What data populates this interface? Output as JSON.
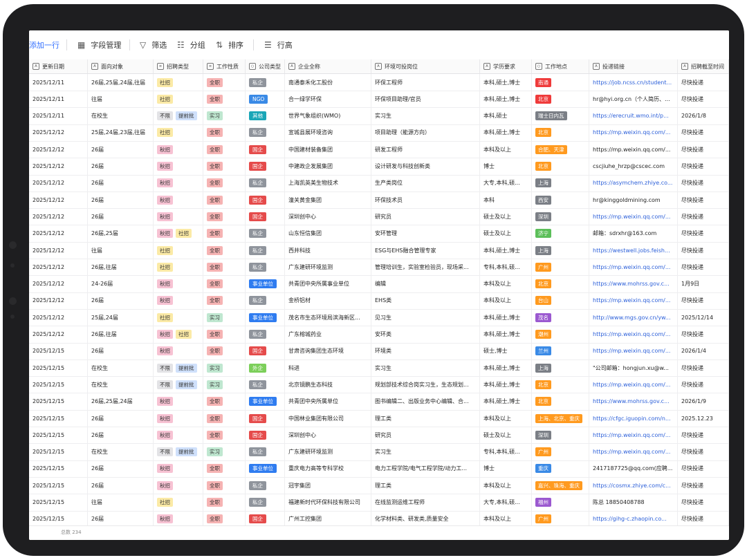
{
  "toolbar": {
    "add_row": "添加一行",
    "field_manage": "字段管理",
    "filter": "筛选",
    "group": "分组",
    "sort": "排序",
    "row_height": "行高"
  },
  "columns": [
    {
      "key": "date",
      "label": "更新日期",
      "icon": "A"
    },
    {
      "key": "target",
      "label": "面向对象",
      "icon": "A"
    },
    {
      "key": "rec",
      "label": "招聘类型",
      "icon": "≡"
    },
    {
      "key": "nature",
      "label": "工作性质",
      "icon": "≡"
    },
    {
      "key": "ctype",
      "label": "公司类型",
      "icon": "○"
    },
    {
      "key": "company",
      "label": "企业全称",
      "icon": "A"
    },
    {
      "key": "position",
      "label": "环境可投岗位",
      "icon": "A"
    },
    {
      "key": "edu",
      "label": "学历要求",
      "icon": "A"
    },
    {
      "key": "loc",
      "label": "工作地点",
      "icon": "○"
    },
    {
      "key": "link",
      "label": "投递链接",
      "icon": "A"
    },
    {
      "key": "deadline",
      "label": "招聘截至时间",
      "icon": "A"
    }
  ],
  "colors": {
    "tag_shezhao": "#fbeaa6",
    "tag_qiuzhao": "#f7c2d3",
    "tag_buxian": "#e3e3e6",
    "tag_tiqianpi": "#cfe0fb",
    "tag_quanzhi": "#f6b3b3",
    "tag_shixi": "#bfe7d0",
    "ctype_siqi": "#8f949c",
    "ctype_guoqi": "#e54b4b",
    "ctype_ngo": "#3a8ae6",
    "ctype_qita": "#1aa6b7",
    "ctype_shiye": "#2f7cf0",
    "ctype_waiqi": "#7ccf5a",
    "link": "#2b5fd9"
  },
  "rows": [
    {
      "date": "2025/12/11",
      "target": "26届,25届,24届,往届",
      "rec": [
        [
          "社招",
          "#fbeaa6"
        ]
      ],
      "nature": [
        [
          "全职",
          "#f6b3b3"
        ]
      ],
      "ctype": [
        "私企",
        "#8f949c"
      ],
      "company": "南通泰禾化工股份",
      "position": "环保工程师",
      "edu": "本科,硕士,博士",
      "loc": [
        [
          "南通",
          "#ef3b3b"
        ]
      ],
      "link": "https://job.ncss.cn/student...",
      "link_style": "link",
      "deadline": "尽快投递"
    },
    {
      "date": "2025/12/11",
      "target": "往届",
      "rec": [
        [
          "社招",
          "#fbeaa6"
        ]
      ],
      "nature": [
        [
          "全职",
          "#f6b3b3"
        ]
      ],
      "ctype": [
        "NGO",
        "#3a8ae6"
      ],
      "company": "合一绿学环保",
      "position": "环保项目助理/官员",
      "edu": "本科,硕士,博士",
      "loc": [
        [
          "北京",
          "#ef3b3b"
        ]
      ],
      "link": "hr@hyi.org.cn（个人简历、...",
      "link_style": "plain",
      "deadline": "尽快投递"
    },
    {
      "date": "2025/12/11",
      "target": "在校生",
      "rec": [
        [
          "不限",
          "#e3e3e6"
        ],
        [
          "提前批",
          "#cfe0fb"
        ]
      ],
      "nature": [
        [
          "实习",
          "#bfe7d0"
        ]
      ],
      "ctype": [
        "其他",
        "#1aa6b7"
      ],
      "company": "世界气象组织(WMO)",
      "position": "实习生",
      "edu": "本科,硕士",
      "loc": [
        [
          "瑞士日内瓦",
          "#7b7f86"
        ]
      ],
      "link": "https://erecruit.wmo.int/p...",
      "link_style": "link",
      "deadline": "2026/1/8"
    },
    {
      "date": "2025/12/12",
      "target": "25届,24届,23届,往届",
      "rec": [
        [
          "社招",
          "#fbeaa6"
        ]
      ],
      "nature": [
        [
          "全职",
          "#f6b3b3"
        ]
      ],
      "ctype": [
        "私企",
        "#8f949c"
      ],
      "company": "宣城县展环境咨询",
      "position": "项目助理（能源方向）",
      "edu": "本科,硕士,博士",
      "loc": [
        [
          "北京",
          "#ff9a1f"
        ]
      ],
      "link": "https://mp.weixin.qq.com/...",
      "link_style": "link",
      "deadline": "尽快投递"
    },
    {
      "date": "2025/12/12",
      "target": "26届",
      "rec": [
        [
          "秋招",
          "#f7c2d3"
        ]
      ],
      "nature": [
        [
          "全职",
          "#f6b3b3"
        ]
      ],
      "ctype": [
        "国企",
        "#e54b4b"
      ],
      "company": "中国建材装备集团",
      "position": "研发工程师",
      "edu": "本科及以上",
      "loc": [
        [
          "合肥、天津",
          "#ff9a1f"
        ]
      ],
      "link": "https://mp.weixin.qq.com/...",
      "link_style": "plain",
      "deadline": "尽快投递"
    },
    {
      "date": "2025/12/12",
      "target": "26届",
      "rec": [
        [
          "秋招",
          "#f7c2d3"
        ]
      ],
      "nature": [
        [
          "全职",
          "#f6b3b3"
        ]
      ],
      "ctype": [
        "国企",
        "#e54b4b"
      ],
      "company": "中建政企发展集团",
      "position": "设计研发与科技创新类",
      "edu": "博士",
      "loc": [
        [
          "北京",
          "#ff9a1f"
        ]
      ],
      "link": "cscjiuhe_hrzp@cscec.com",
      "link_style": "plain",
      "deadline": "尽快投递"
    },
    {
      "date": "2025/12/12",
      "target": "26届",
      "rec": [
        [
          "秋招",
          "#f7c2d3"
        ]
      ],
      "nature": [
        [
          "全职",
          "#f6b3b3"
        ]
      ],
      "ctype": [
        "私企",
        "#8f949c"
      ],
      "company": "上海凯英美生物技术",
      "position": "生产类岗位",
      "edu": "大专,本科,硕...",
      "loc": [
        [
          "上海",
          "#7b7f86"
        ]
      ],
      "link": "https://asymchem.zhiye.co...",
      "link_style": "link",
      "deadline": "尽快投递"
    },
    {
      "date": "2025/12/12",
      "target": "26届",
      "rec": [
        [
          "秋招",
          "#f7c2d3"
        ]
      ],
      "nature": [
        [
          "全职",
          "#f6b3b3"
        ]
      ],
      "ctype": [
        "国企",
        "#e54b4b"
      ],
      "company": "潼关黄金集团",
      "position": "环保技术员",
      "edu": "本科",
      "loc": [
        [
          "西安",
          "#7b7f86"
        ]
      ],
      "link": "hr@kinggoldmining.com",
      "link_style": "plain",
      "deadline": "尽快投递"
    },
    {
      "date": "2025/12/12",
      "target": "26届",
      "rec": [
        [
          "秋招",
          "#f7c2d3"
        ]
      ],
      "nature": [
        [
          "全职",
          "#f6b3b3"
        ]
      ],
      "ctype": [
        "国企",
        "#e54b4b"
      ],
      "company": "深圳创中心",
      "position": "研究员",
      "edu": "硕士及以上",
      "loc": [
        [
          "深圳",
          "#7b7f86"
        ]
      ],
      "link": "https://mp.weixin.qq.com/...",
      "link_style": "link",
      "deadline": "尽快投递"
    },
    {
      "date": "2025/12/12",
      "target": "26届,25届",
      "rec": [
        [
          "秋招",
          "#f7c2d3"
        ],
        [
          "社招",
          "#fbeaa6"
        ]
      ],
      "nature": [
        [
          "全职",
          "#f6b3b3"
        ]
      ],
      "ctype": [
        "私企",
        "#8f949c"
      ],
      "company": "山东恒信集团",
      "position": "安环管理",
      "edu": "硕士及以上",
      "loc": [
        [
          "济宁",
          "#5cbf5a"
        ]
      ],
      "link": "邮箱：sdrxhr@163.com",
      "link_style": "plain",
      "deadline": "尽快投递"
    },
    {
      "date": "2025/12/12",
      "target": "往届",
      "rec": [
        [
          "社招",
          "#fbeaa6"
        ]
      ],
      "nature": [
        [
          "全职",
          "#f6b3b3"
        ]
      ],
      "ctype": [
        "私企",
        "#8f949c"
      ],
      "company": "西井科技",
      "position": "ESG与EHS融合管理专家",
      "edu": "本科,硕士,博士",
      "loc": [
        [
          "上海",
          "#7b7f86"
        ]
      ],
      "link": "https://westwell.jobs.feish...",
      "link_style": "link",
      "deadline": "尽快投递"
    },
    {
      "date": "2025/12/12",
      "target": "26届,往届",
      "rec": [
        [
          "社招",
          "#fbeaa6"
        ]
      ],
      "nature": [
        [
          "全职",
          "#f6b3b3"
        ]
      ],
      "ctype": [
        "私企",
        "#8f949c"
      ],
      "company": "广东建研环境监测",
      "position": "管理培训生，实验室检验员，现场采...",
      "edu": "专科,本科,硕...",
      "loc": [
        [
          "广州",
          "#ff9a1f"
        ]
      ],
      "link": "https://mp.weixin.qq.com/...",
      "link_style": "link",
      "deadline": "尽快投递"
    },
    {
      "date": "2025/12/12",
      "target": "24-26届",
      "rec": [
        [
          "秋招",
          "#f7c2d3"
        ]
      ],
      "nature": [
        [
          "全职",
          "#f6b3b3"
        ]
      ],
      "ctype": [
        "事业单位",
        "#2f7cf0"
      ],
      "company": "共青团中央所属事业单位",
      "position": "编辑",
      "edu": "本科及以上",
      "loc": [
        [
          "北京",
          "#ff9a1f"
        ]
      ],
      "link": "https://www.mohrss.gov.c...",
      "link_style": "link",
      "deadline": "1月9日"
    },
    {
      "date": "2025/12/12",
      "target": "26届",
      "rec": [
        [
          "秋招",
          "#f7c2d3"
        ]
      ],
      "nature": [
        [
          "全职",
          "#f6b3b3"
        ]
      ],
      "ctype": [
        "私企",
        "#8f949c"
      ],
      "company": "金桥铝材",
      "position": "EHS类",
      "edu": "本科及以上",
      "loc": [
        [
          "台山",
          "#ff9a1f"
        ]
      ],
      "link": "https://mp.weixin.qq.com/...",
      "link_style": "link",
      "deadline": "尽快投递"
    },
    {
      "date": "2025/12/12",
      "target": "25届,24届",
      "rec": [
        [
          "社招",
          "#fbeaa6"
        ]
      ],
      "nature": [
        [
          "实习",
          "#bfe7d0"
        ]
      ],
      "ctype": [
        "事业单位",
        "#2f7cf0"
      ],
      "company": "茂名市生态环境局滨海新区...",
      "position": "见习生",
      "edu": "本科,硕士,博士",
      "loc": [
        [
          "茂名",
          "#9b59d0"
        ]
      ],
      "link": "http://www.mgs.gov.cn/yw...",
      "link_style": "link",
      "deadline": "2025/12/14"
    },
    {
      "date": "2025/12/12",
      "target": "26届,往届",
      "rec": [
        [
          "秋招",
          "#f7c2d3"
        ],
        [
          "社招",
          "#fbeaa6"
        ]
      ],
      "nature": [
        [
          "全职",
          "#f6b3b3"
        ]
      ],
      "ctype": [
        "私企",
        "#8f949c"
      ],
      "company": "广东榕城药业",
      "position": "安环类",
      "edu": "本科,硕士,博士",
      "loc": [
        [
          "潮州",
          "#ff9a1f"
        ]
      ],
      "link": "https://mp.weixin.qq.com/...",
      "link_style": "link",
      "deadline": "尽快投递"
    },
    {
      "date": "2025/12/15",
      "target": "26届",
      "rec": [
        [
          "秋招",
          "#f7c2d3"
        ]
      ],
      "nature": [
        [
          "全职",
          "#f6b3b3"
        ]
      ],
      "ctype": [
        "国企",
        "#e54b4b"
      ],
      "company": "甘肃咨询集团生态环境",
      "position": "环境类",
      "edu": "硕士,博士",
      "loc": [
        [
          "兰州",
          "#3a8ae6"
        ]
      ],
      "link": "https://mp.weixin.qq.com/...",
      "link_style": "link",
      "deadline": "2026/1/4"
    },
    {
      "date": "2025/12/15",
      "target": "在校生",
      "rec": [
        [
          "不限",
          "#e3e3e6"
        ],
        [
          "提前批",
          "#cfe0fb"
        ]
      ],
      "nature": [
        [
          "实习",
          "#bfe7d0"
        ]
      ],
      "ctype": [
        "外企",
        "#7ccf5a"
      ],
      "company": "科进",
      "position": "实习生",
      "edu": "本科,硕士,博士",
      "loc": [
        [
          "上海",
          "#7b7f86"
        ]
      ],
      "link": "\"公司邮箱：hongjun.xu@w...",
      "link_style": "plain",
      "deadline": "尽快投递"
    },
    {
      "date": "2025/12/15",
      "target": "在校生",
      "rec": [
        [
          "不限",
          "#e3e3e6"
        ],
        [
          "提前批",
          "#cfe0fb"
        ]
      ],
      "nature": [
        [
          "实习",
          "#bfe7d0"
        ]
      ],
      "ctype": [
        "私企",
        "#8f949c"
      ],
      "company": "北京镜鹏生态科技",
      "position": "规划部技术综合岗实习生，生态规划...",
      "edu": "本科,硕士,博士",
      "loc": [
        [
          "北京",
          "#ff9a1f"
        ]
      ],
      "link": "https://mp.weixin.qq.com/...",
      "link_style": "link",
      "deadline": "尽快投递"
    },
    {
      "date": "2025/12/15",
      "target": "26届,25届,24届",
      "rec": [
        [
          "秋招",
          "#f7c2d3"
        ]
      ],
      "nature": [
        [
          "全职",
          "#f6b3b3"
        ]
      ],
      "ctype": [
        "事业单位",
        "#2f7cf0"
      ],
      "company": "共青团中央所属单位",
      "position": "图书编辑二、出版业务中心编辑、合...",
      "edu": "本科,硕士,博士",
      "loc": [
        [
          "北京",
          "#ff9a1f"
        ]
      ],
      "link": "https://www.mohrss.gov.c...",
      "link_style": "link",
      "deadline": "2026/1/9"
    },
    {
      "date": "2025/12/15",
      "target": "26届",
      "rec": [
        [
          "秋招",
          "#f7c2d3"
        ]
      ],
      "nature": [
        [
          "全职",
          "#f6b3b3"
        ]
      ],
      "ctype": [
        "国企",
        "#e54b4b"
      ],
      "company": "中国林业集团有限公司",
      "position": "理工类",
      "edu": "本科及以上",
      "loc": [
        [
          "上海、北京、重庆",
          "#ff9a1f"
        ]
      ],
      "link": "https://cfgc.iguopin.com/n...",
      "link_style": "link",
      "deadline": "2025.12.23"
    },
    {
      "date": "2025/12/15",
      "target": "26届",
      "rec": [
        [
          "秋招",
          "#f7c2d3"
        ]
      ],
      "nature": [
        [
          "全职",
          "#f6b3b3"
        ]
      ],
      "ctype": [
        "国企",
        "#e54b4b"
      ],
      "company": "深圳创中心",
      "position": "研究员",
      "edu": "硕士及以上",
      "loc": [
        [
          "深圳",
          "#7b7f86"
        ]
      ],
      "link": "https://mp.weixin.qq.com/...",
      "link_style": "link",
      "deadline": "尽快投递"
    },
    {
      "date": "2025/12/15",
      "target": "在校生",
      "rec": [
        [
          "不限",
          "#e3e3e6"
        ],
        [
          "提前批",
          "#cfe0fb"
        ]
      ],
      "nature": [
        [
          "实习",
          "#bfe7d0"
        ]
      ],
      "ctype": [
        "私企",
        "#8f949c"
      ],
      "company": "广东建研环境监测",
      "position": "实习生",
      "edu": "专科,本科,硕...",
      "loc": [
        [
          "广州",
          "#ff9a1f"
        ]
      ],
      "link": "https://mp.weixin.qq.com/...",
      "link_style": "link",
      "deadline": "尽快投递"
    },
    {
      "date": "2025/12/15",
      "target": "26届",
      "rec": [
        [
          "秋招",
          "#f7c2d3"
        ]
      ],
      "nature": [
        [
          "全职",
          "#f6b3b3"
        ]
      ],
      "ctype": [
        "事业单位",
        "#2f7cf0"
      ],
      "company": "重庆电力高等专科学校",
      "position": "电力工程学院/电气工程学院/动力工...",
      "edu": "博士",
      "loc": [
        [
          "重庆",
          "#3a8ae6"
        ]
      ],
      "link": "2417187725@qq.com(应聘...",
      "link_style": "plain",
      "deadline": "尽快投递"
    },
    {
      "date": "2025/12/15",
      "target": "26届",
      "rec": [
        [
          "秋招",
          "#f7c2d3"
        ]
      ],
      "nature": [
        [
          "全职",
          "#f6b3b3"
        ]
      ],
      "ctype": [
        "私企",
        "#8f949c"
      ],
      "company": "冠宇集团",
      "position": "理工类",
      "edu": "本科及以上",
      "loc": [
        [
          "嘉兴、珠海、重庆",
          "#ff9a1f"
        ]
      ],
      "link": "https://cosmx.zhiye.com/c...",
      "link_style": "link",
      "deadline": "尽快投递"
    },
    {
      "date": "2025/12/15",
      "target": "往届",
      "rec": [
        [
          "社招",
          "#fbeaa6"
        ]
      ],
      "nature": [
        [
          "全职",
          "#f6b3b3"
        ]
      ],
      "ctype": [
        "私企",
        "#8f949c"
      ],
      "company": "福建新时代环保科技有限公司",
      "position": "在线监测运维工程师",
      "edu": "大专,本科,硕...",
      "loc": [
        [
          "福州",
          "#9b59d0"
        ]
      ],
      "link": "陈总 18850408788",
      "link_style": "plain",
      "deadline": "尽快投递"
    },
    {
      "date": "2025/12/15",
      "target": "26届",
      "rec": [
        [
          "秋招",
          "#f7c2d3"
        ]
      ],
      "nature": [
        [
          "全职",
          "#f6b3b3"
        ]
      ],
      "ctype": [
        "国企",
        "#e54b4b"
      ],
      "company": "广州工控集团",
      "position": "化学材料类、研发类,质量安全",
      "edu": "本科及以上",
      "loc": [
        [
          "广州",
          "#ff9a1f"
        ]
      ],
      "link": "https://gihg-c.zhaopin.co...",
      "link_style": "link",
      "deadline": "尽快投递"
    }
  ],
  "footer": {
    "count": "总数 234"
  }
}
